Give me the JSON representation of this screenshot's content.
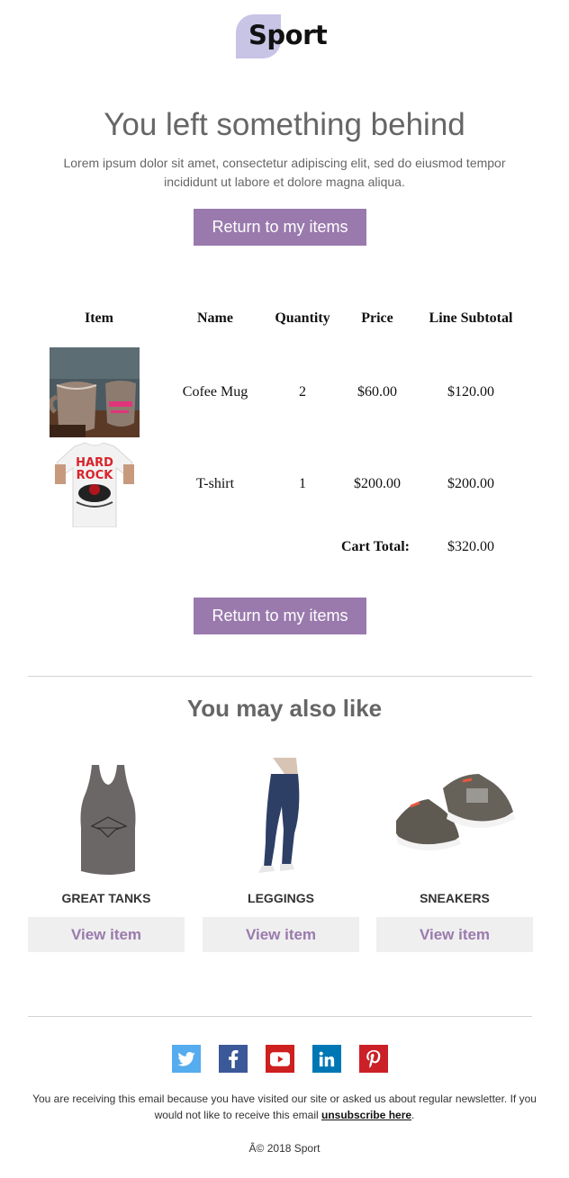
{
  "brand": {
    "logo_text": "Sport",
    "accent": "#9a7aad",
    "logo_shape": "#c7c4e6"
  },
  "hero": {
    "title": "You left something behind",
    "body": "Lorem ipsum dolor sit amet, consectetur adipiscing elit, sed do eiusmod tempor incididunt ut labore et dolore magna aliqua.",
    "button_label": "Return to my items"
  },
  "cart": {
    "headers": [
      "Item",
      "Name",
      "Quantity",
      "Price",
      "Line Subtotal"
    ],
    "rows": [
      {
        "image": "coffee-mug-photo",
        "name": "Cofee Mug",
        "quantity": "2",
        "price": "$60.00",
        "subtotal": "$120.00"
      },
      {
        "image": "t-shirt-photo",
        "name": "T-shirt",
        "quantity": "1",
        "price": "$200.00",
        "subtotal": "$200.00"
      }
    ],
    "total_label": "Cart Total:",
    "total_value": "$320.00",
    "button_label": "Return to my items"
  },
  "recommendations": {
    "title": "You may also like",
    "items": [
      {
        "name": "GREAT TANKS",
        "image": "tank-top-photo",
        "button": "View item"
      },
      {
        "name": "LEGGINGS",
        "image": "leggings-photo",
        "button": "View item"
      },
      {
        "name": "SNEAKERS",
        "image": "sneakers-photo",
        "button": "View item"
      }
    ]
  },
  "social": [
    {
      "name": "twitter-icon",
      "color": "#55acee"
    },
    {
      "name": "facebook-icon",
      "color": "#3b5998"
    },
    {
      "name": "youtube-icon",
      "color": "#cd201f"
    },
    {
      "name": "linkedin-icon",
      "color": "#0077b5"
    },
    {
      "name": "pinterest-icon",
      "color": "#cb2027"
    }
  ],
  "footer": {
    "text_before": "You are receiving this email because you have visited our site or asked us about regular newsletter. If you would not like to receive this email ",
    "unsubscribe_label": "unsubscribe here",
    "text_after": ".",
    "copyright": "Â© 2018 Sport"
  }
}
